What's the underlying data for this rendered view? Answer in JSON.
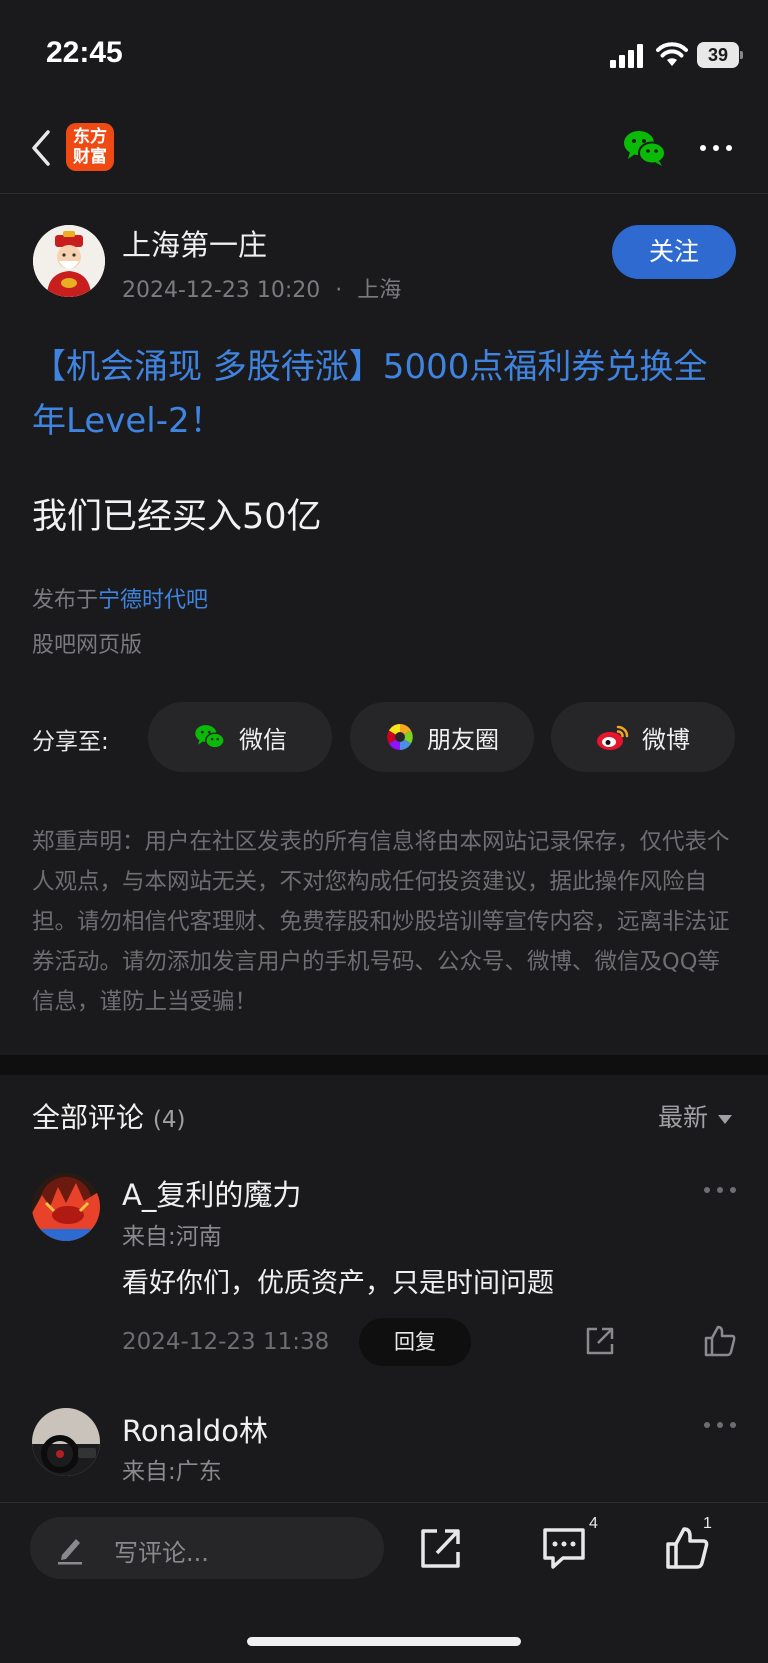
{
  "status_bar": {
    "time": "22:45",
    "battery": "39"
  },
  "nav": {
    "logo_line1": "东方",
    "logo_line2": "财富"
  },
  "post": {
    "author": "上海第一庄",
    "date": "2024-12-23 10:20",
    "location": "上海",
    "meta_separator": "·",
    "follow_label": "关注",
    "title": "【机会涌现 多股待涨】5000点福利券兑换全年Level-2！",
    "content": "我们已经买入50亿",
    "published_prefix": "发布于",
    "forum": "宁德时代吧",
    "web_version": "股吧网页版",
    "share_label": "分享至:",
    "share_options": [
      "微信",
      "朋友圈",
      "微博"
    ],
    "disclaimer": "郑重声明：用户在社区发表的所有信息将由本网站记录保存，仅代表个人观点，与本网站无关，不对您构成任何投资建议，据此操作风险自担。请勿相信代客理财、免费荐股和炒股培训等宣传内容，远离非法证券活动。请勿添加发言用户的手机号码、公众号、微博、微信及QQ等信息，谨防上当受骗！"
  },
  "comments": {
    "title": "全部评论",
    "count": "(4)",
    "sort": "最新",
    "items": [
      {
        "name": "A_复利的魔力",
        "from": "来自:河南",
        "text": "看好你们，优质资产，只是时间问题",
        "date": "2024-12-23 11:38",
        "reply_label": "回复"
      },
      {
        "name": "Ronaldo林",
        "from": "来自:广东"
      }
    ]
  },
  "bottom_bar": {
    "placeholder": "写评论...",
    "comment_count": "4",
    "like_count": "1"
  },
  "colors": {
    "background": "#1a1a1c",
    "accent_blue": "#3f84e0",
    "follow_button": "#2f6ad0",
    "brand_orange": "#f04a14",
    "wechat_green": "#09bb07"
  }
}
